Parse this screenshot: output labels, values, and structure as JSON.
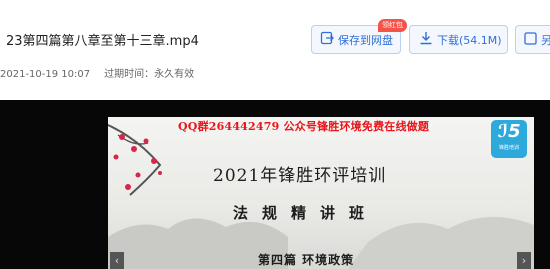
{
  "file": {
    "title": "23第四篇第八章至第十三章.mp4",
    "upload_time": "2021-10-19 10:07",
    "expiry_label": "过期时间：",
    "expiry_value": "永久有效"
  },
  "actions": {
    "save_label": "保存到网盘",
    "save_badge": "领红包",
    "download_label": "下载(54.1M)",
    "more_label": "另"
  },
  "slide": {
    "banner": "QQ群264442479 公众号锋胜环境免费在线做题",
    "logo_text": "ℐ5",
    "logo_caption": "锋胜培训",
    "title": "2021年锋胜环评培训",
    "subtitle": "法规精讲班",
    "chapter": "第四篇 环境政策"
  },
  "colors": {
    "accent": "#2f6fd6",
    "badge": "#f55248",
    "banner": "#e8151b",
    "logo": "#2ea9dc"
  },
  "icons": {
    "save": "save-to-cloud-icon",
    "download": "download-icon",
    "more": "more-icon",
    "prev": "chevron-left-icon",
    "next": "chevron-right-icon"
  }
}
